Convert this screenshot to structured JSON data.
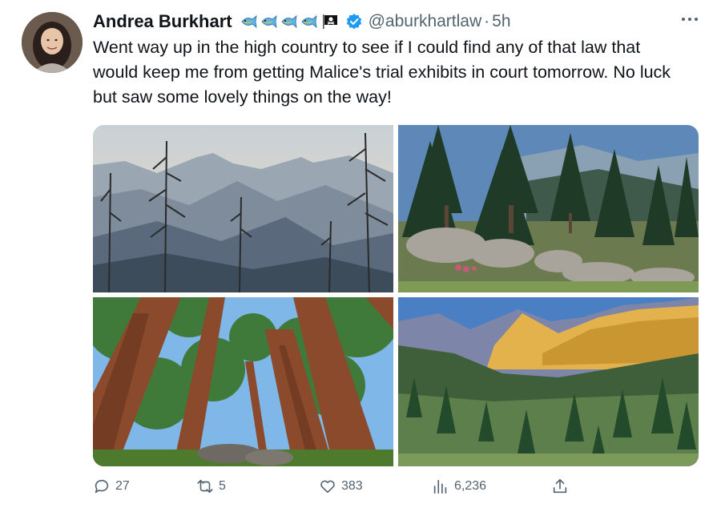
{
  "author": {
    "display_name": "Andrea Burkhart",
    "handle": "@aburkhartlaw",
    "separator": "·",
    "time": "5h",
    "emoji_icons": [
      "fish-icon",
      "fish-icon",
      "fish-icon",
      "fish-icon",
      "pirate-flag-icon"
    ],
    "verified_color": "#1d9bf0"
  },
  "tweet": {
    "text": "Went way up in the high country to see if I could find any of that law that would keep me from getting Malice's trial exhibits in court tomorrow. No luck but saw some lovely things on the way!"
  },
  "media": [
    "photo-mountain-haze",
    "photo-forest-boulders",
    "photo-sequoia-trunks",
    "photo-alpine-valley"
  ],
  "actions": {
    "replies": "27",
    "reposts": "5",
    "likes": "383",
    "views": "6,236"
  },
  "colors": {
    "text": "#0f1419",
    "secondary": "#536471",
    "accent": "#1d9bf0"
  }
}
